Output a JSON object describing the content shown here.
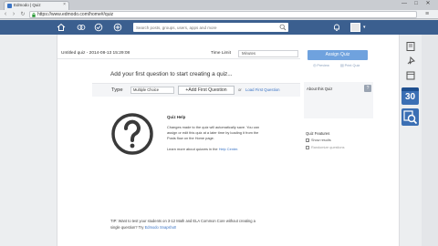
{
  "browser": {
    "tab_title": "Edmodo | Quiz",
    "url": "https://www.edmodo.com/home#/quiz",
    "window_buttons": [
      "—",
      "□",
      "✕"
    ]
  },
  "header": {
    "search_placeholder": "Search posts, groups, users, apps and more"
  },
  "quiz": {
    "title": "Untitled quiz - 2014-08-13 15:29:08",
    "time_limit_label": "Time Limit",
    "time_limit_value": "Minutes"
  },
  "main": {
    "heading": "Add your first question to start creating a quiz...",
    "type_label": "Type",
    "type_value": "Multiple Choice",
    "add_button": "+Add First Question",
    "or_text": "or",
    "load_link": "Load First Question"
  },
  "help": {
    "title": "Quiz Help",
    "lines": [
      "Changes made to the quiz will automatically save. You can",
      "assign or edit this quiz at a later time by loading it from the",
      "Posts flow on the Home page."
    ],
    "learn_prefix": "Learn more about quizzes in the",
    "help_center": "Help Center."
  },
  "tip": {
    "line1": "TIP: Want to test your students on 3-12 Math and ELA Common Core without creating a",
    "line2_prefix": "single question? Try",
    "link": "Edmodo Snapshot!"
  },
  "sidebar": {
    "assign_button": "Assign Quiz",
    "preview_link": "Preview",
    "print_link": "Print Quiz",
    "about_label": "About this Quiz",
    "about_help": "?",
    "features_label": "Quiz Features",
    "show_results": "Show results",
    "randomize": "Randomize questions"
  },
  "toolstrip": {
    "badge_number": "30"
  },
  "colors": {
    "header_bg": "#3b5f8f",
    "assign_button": "#6fa2de",
    "link": "#3b74c5"
  }
}
